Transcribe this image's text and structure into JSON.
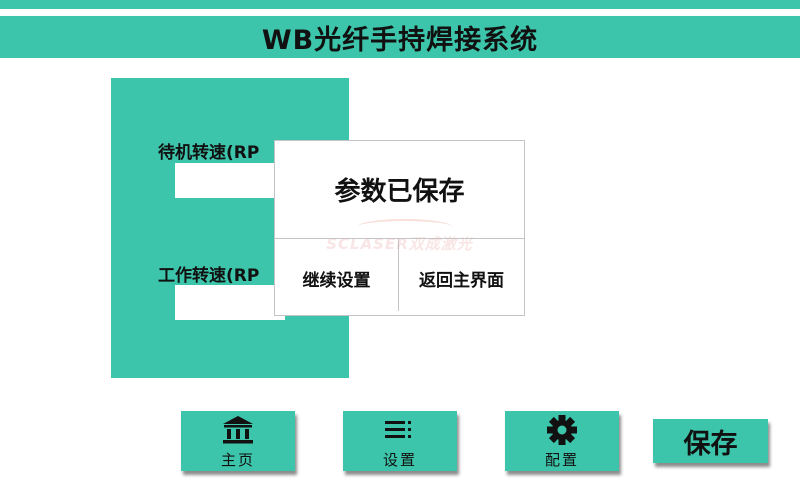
{
  "header": {
    "title": "WB光纤手持焊接系统"
  },
  "form": {
    "standby_speed_label": "待机转速(RP",
    "work_speed_label": "工作转速(RP",
    "standby_speed_value": "",
    "work_speed_value": ""
  },
  "dialog": {
    "title": "参数已保存",
    "continue_label": "继续设置",
    "return_label": "返回主界面",
    "watermark": "SCLASER双成激光"
  },
  "nav": {
    "home_label": "主页",
    "settings_label": "设置",
    "config_label": "配置",
    "save_label": "保存"
  },
  "colors": {
    "accent": "#3cc5aa",
    "dialog_border": "#c4c4c4",
    "text": "#111111"
  },
  "icons": {
    "home": "bank-icon",
    "settings": "list-menu-icon",
    "config": "gear-icon"
  }
}
